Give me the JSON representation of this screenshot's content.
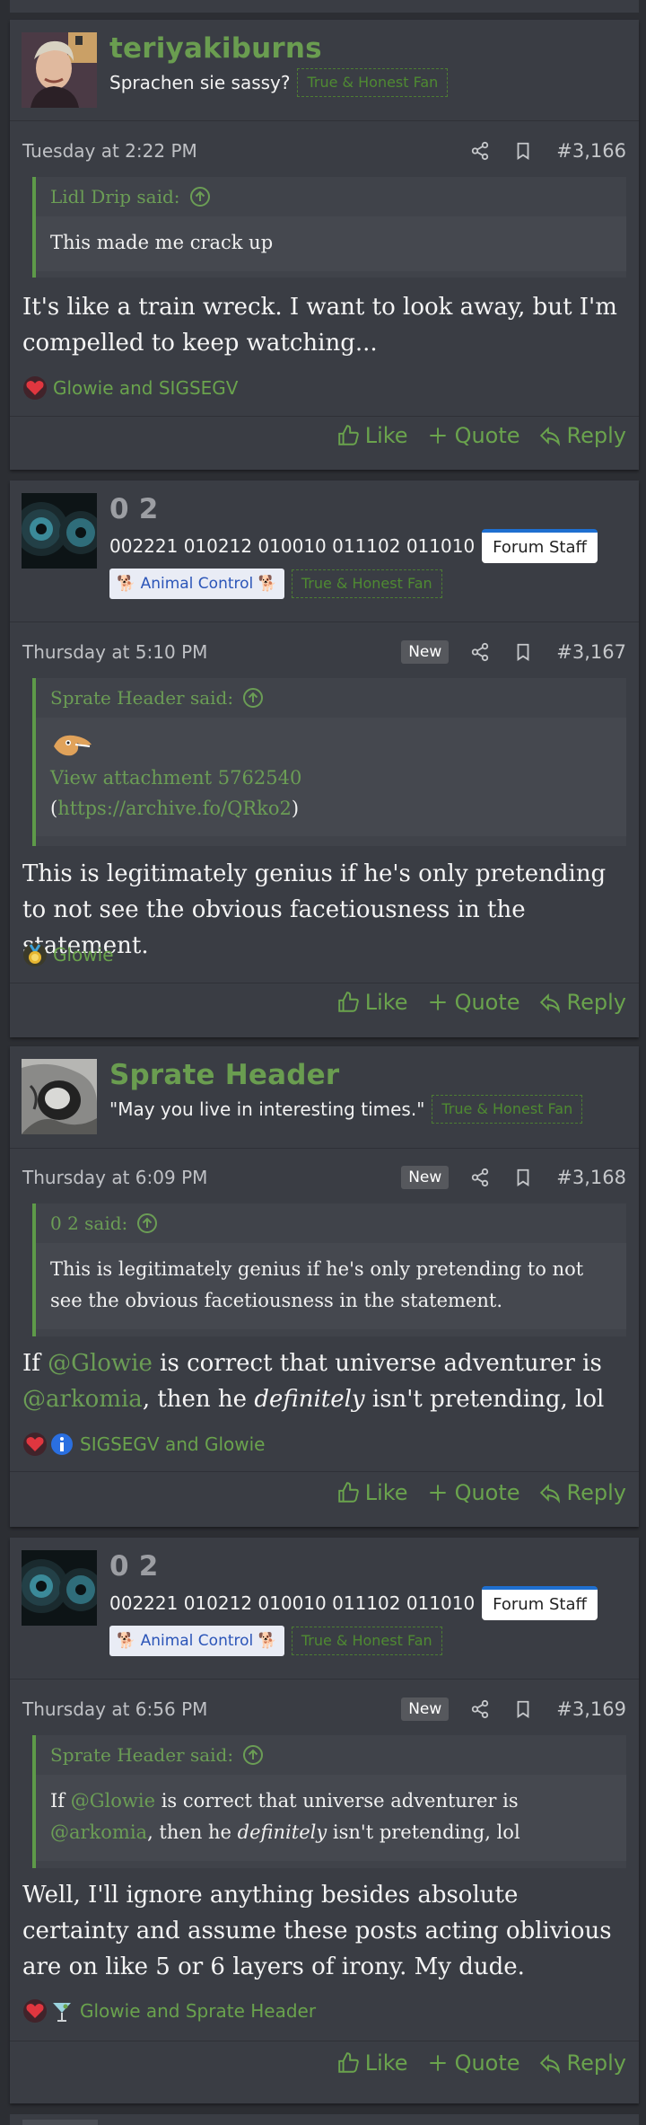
{
  "posts": [
    {
      "username": "teriyakiburns",
      "user_title": "Sprachen sie sassy?",
      "badges": {
        "fh": "True & Honest Fan"
      },
      "date": "Tuesday at 2:22 PM",
      "is_new": false,
      "post_number": "#3,166",
      "quote": {
        "author": "Lidl Drip said:",
        "lines": [
          "This made me crack up"
        ]
      },
      "body": "It's like a train wreck. I want to look away, but I'm compelled to keep watching...",
      "reactions": {
        "icons": [
          "heart-icon"
        ],
        "names": "Glowie and SIGSEGV"
      }
    },
    {
      "username": "0 2",
      "user_title": "002221 010212 010010 011102 011010",
      "badges": {
        "staff": "Forum Staff",
        "ac": "🐕 Animal Control 🐕",
        "fh": "True & Honest Fan"
      },
      "date": "Thursday at 5:10 PM",
      "is_new": true,
      "new_label": "New",
      "post_number": "#3,167",
      "quote": {
        "author": "Sprate Header said:",
        "attachment": "View attachment 5762540",
        "archive_link": "https://archive.fo/QRko2",
        "paren_open": "(",
        "paren_close": ")"
      },
      "body": "This is legitimately genius if he's only pretending to not see the obvious facetiousness in the statement.",
      "reactions": {
        "icons": [
          "medal-icon"
        ],
        "names": "Glowie"
      }
    },
    {
      "username": "Sprate Header",
      "user_title": "\"May you live in interesting times.\"",
      "badges": {
        "fh": "True & Honest Fan"
      },
      "date": "Thursday at 6:09 PM",
      "is_new": true,
      "new_label": "New",
      "post_number": "#3,168",
      "quote": {
        "author": "0 2 said:",
        "text": "This is legitimately genius if he's only pretending to not see the obvious facetiousness in the statement."
      },
      "body_parts": {
        "p1": "If ",
        "m1": "@Glowie",
        "p2": " is correct that universe adventurer is ",
        "m2": "@arkomia",
        "p3": ", then he ",
        "em": "definitely",
        "p4": " isn't pretending, lol"
      },
      "reactions": {
        "icons": [
          "heart-icon",
          "info-icon"
        ],
        "names": "SIGSEGV and Glowie"
      }
    },
    {
      "username": "0 2",
      "user_title": "002221 010212 010010 011102 011010",
      "badges": {
        "staff": "Forum Staff",
        "ac": "🐕 Animal Control 🐕",
        "fh": "True & Honest Fan"
      },
      "date": "Thursday at 6:56 PM",
      "is_new": true,
      "new_label": "New",
      "post_number": "#3,169",
      "quote": {
        "author": "Sprate Header said:",
        "parts": {
          "p1": "If ",
          "m1": "@Glowie",
          "p2": " is correct that universe adventurer is ",
          "m2": "@arkomia",
          "p3": ", then he ",
          "em": "definitely",
          "p4": " isn't pretending, lol"
        }
      },
      "body": "Well, I'll ignore anything besides absolute certainty and assume these posts acting oblivious are on like 5 or 6 layers of irony. My dude.",
      "reactions": {
        "icons": [
          "heart-icon",
          "cocktail-icon"
        ],
        "names": "Glowie and Sprate Header"
      }
    }
  ],
  "actions": {
    "like": "Like",
    "quote": "Quote",
    "reply": "Reply"
  },
  "colors": {
    "accent": "#6aa34d",
    "background": "#2c2e33",
    "post_bg": "#3a3d44"
  }
}
